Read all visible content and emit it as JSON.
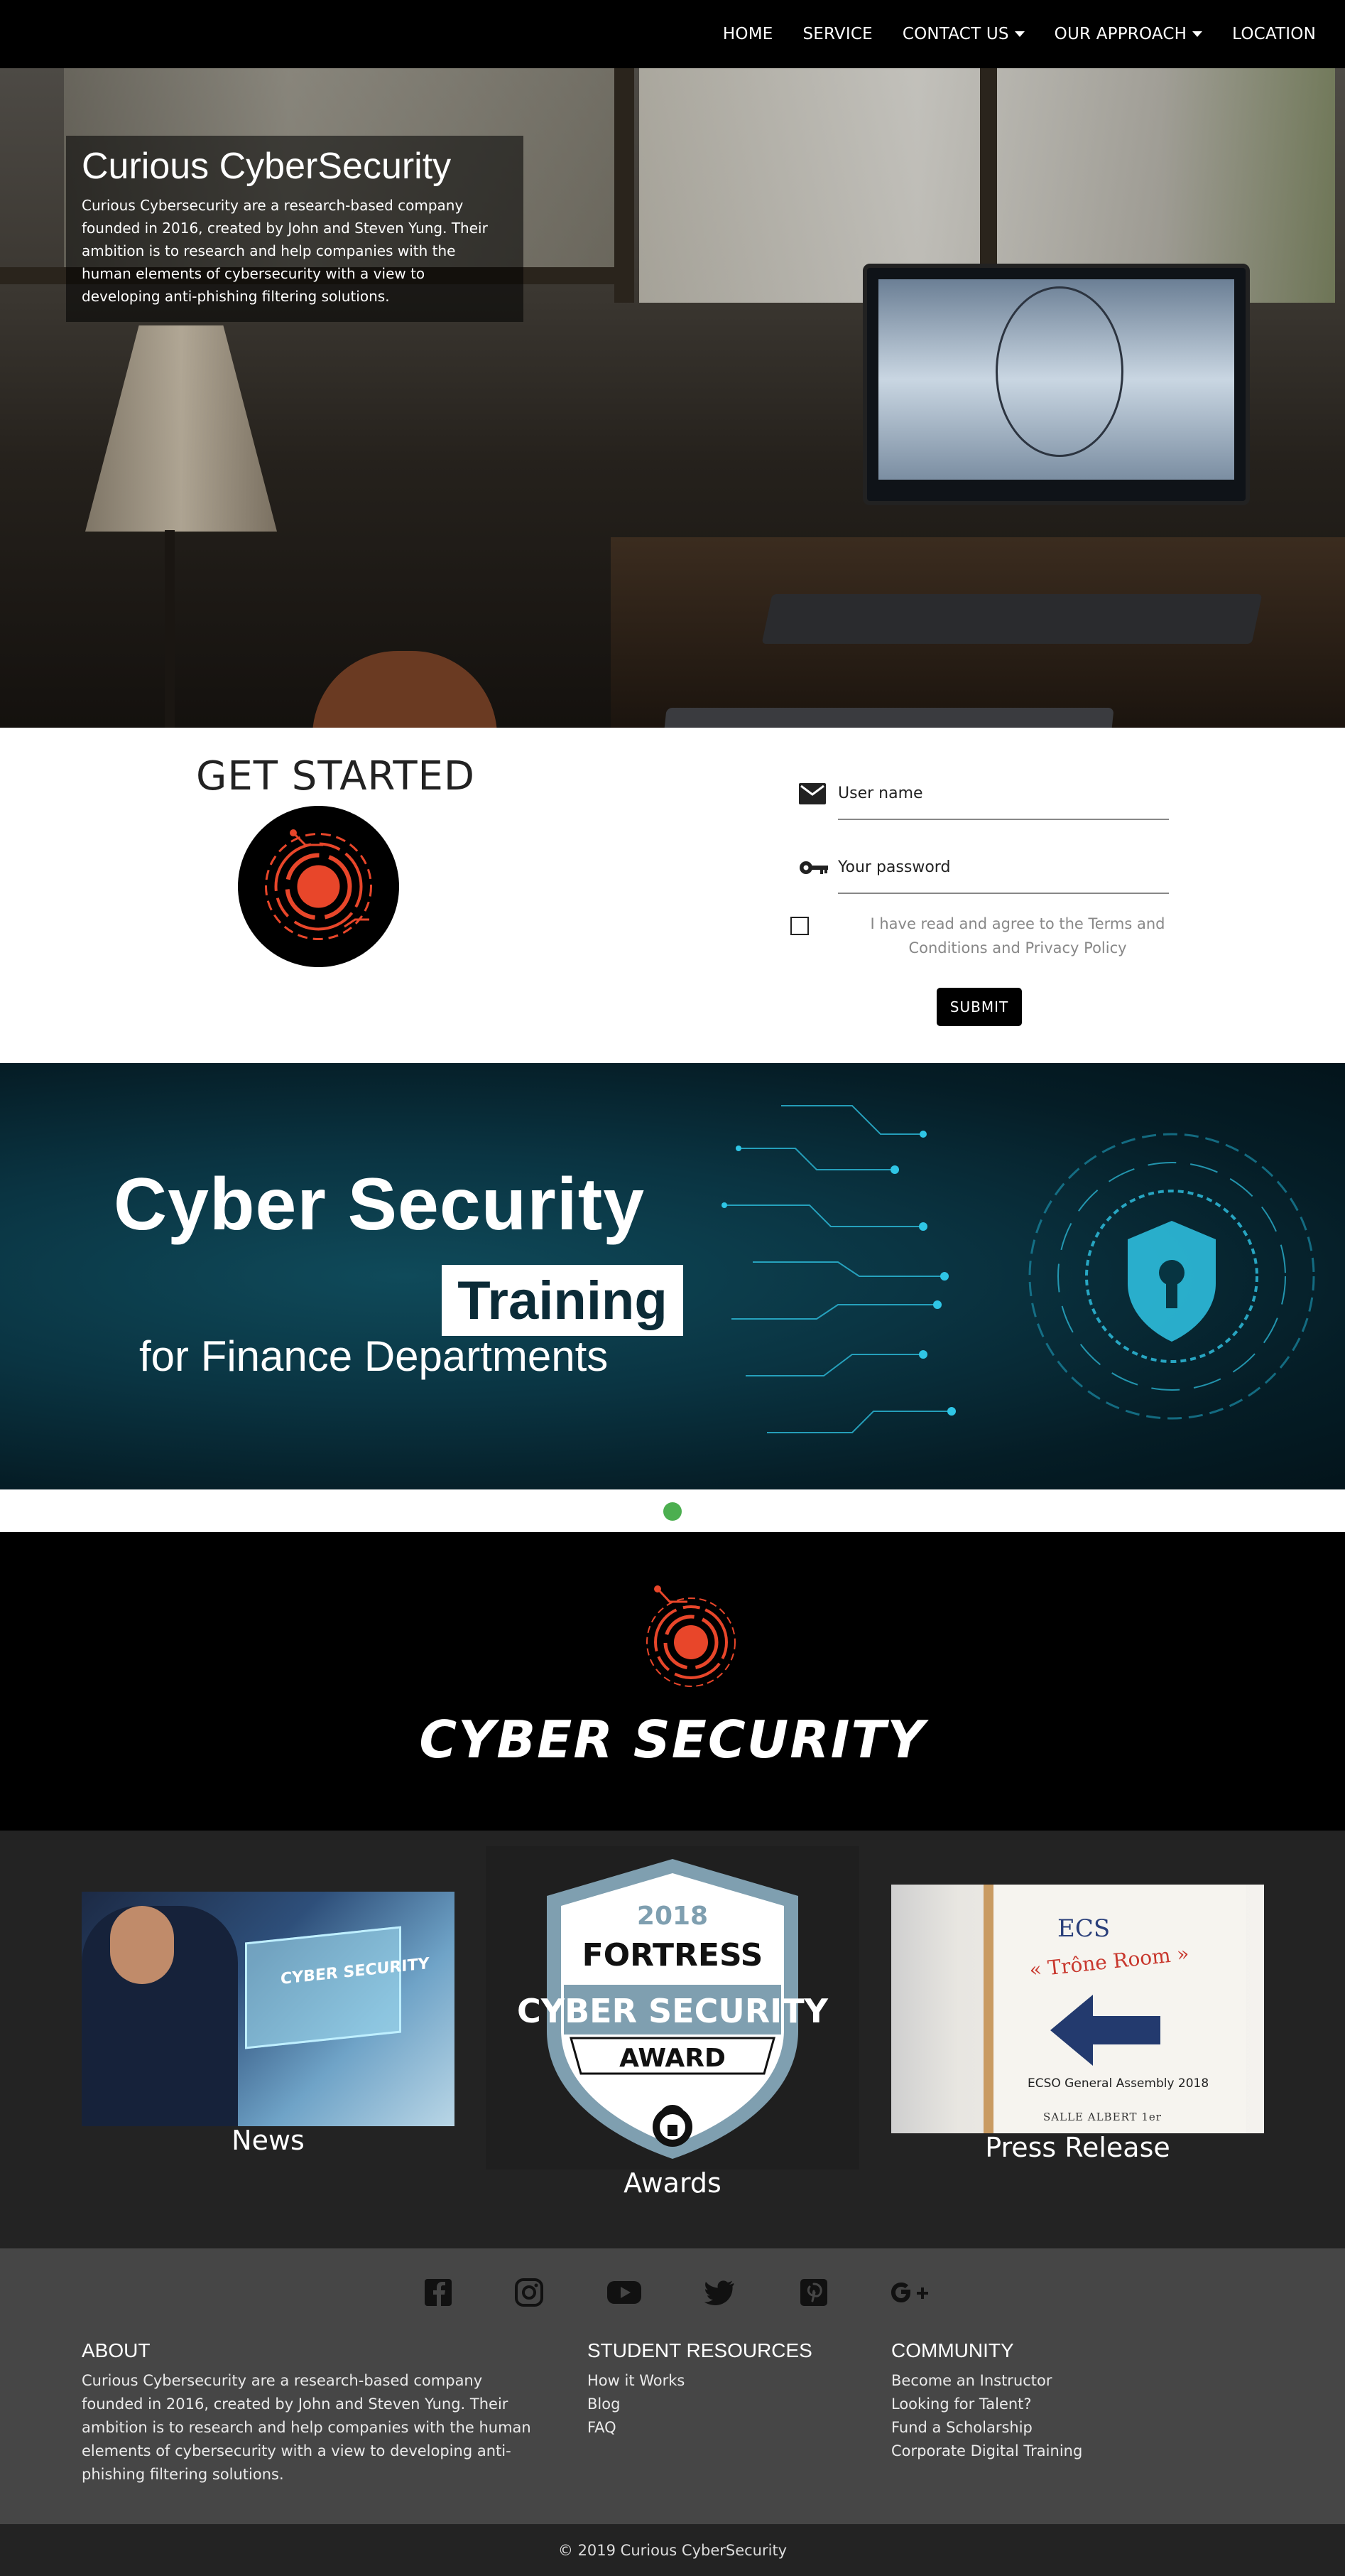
{
  "nav": {
    "items": [
      {
        "label": "HOME",
        "dropdown": false
      },
      {
        "label": "SERVICE",
        "dropdown": false
      },
      {
        "label": "CONTACT US",
        "dropdown": true
      },
      {
        "label": "OUR APPROACH",
        "dropdown": true
      },
      {
        "label": "LOCATION",
        "dropdown": false
      }
    ]
  },
  "hero": {
    "title": "Curious CyberSecurity",
    "text": "Curious Cybersecurity are a research-based company founded in 2016, created by John and Steven Yung. Their ambition is to research and help companies with the human elements of cybersecurity with a view to developing anti-phishing filtering solutions."
  },
  "get_started": {
    "title": "GET STARTED",
    "username_label": "User name",
    "password_label": "Your password",
    "terms_text": "I have read and agree to the Terms and Conditions and Privacy Policy",
    "submit_label": "SUBMIT"
  },
  "banner": {
    "line1": "Cyber Security",
    "line2": "Training",
    "line3": "for Finance Departments",
    "colors": {
      "background": "#0a3442",
      "accent": "#2fc6e6"
    }
  },
  "carousel": {
    "active_dot_color": "#4caf50"
  },
  "brand": {
    "text": "CYBER SECURITY",
    "logo_color": "#e8462a"
  },
  "cards": {
    "news_label": "News",
    "news_image_text": "CYBER SECURITY",
    "awards_label": "Awards",
    "award_year": "2018",
    "award_fortress": "FORTRESS",
    "award_cyber": "CYBER SECURITY",
    "award_word": "AWARD",
    "press_label": "Press Release",
    "press_ecs": "ECS",
    "press_room": "« Trône Room »",
    "press_assembly": "ECSO General Assembly 2018",
    "press_salle": "SALLE ALBERT 1er"
  },
  "footer": {
    "social_icons": [
      "facebook-icon",
      "instagram-icon",
      "youtube-icon",
      "twitter-icon",
      "pinterest-icon",
      "google-plus-icon"
    ],
    "about_title": "ABOUT",
    "about_text": "Curious Cybersecurity are a research-based company founded in 2016, created by John and Steven Yung. Their ambition is to research and help companies with the human elements of cybersecurity with a view to developing anti-phishing filtering solutions.",
    "student_title": "STUDENT RESOURCES",
    "student_links": [
      "How it Works",
      "Blog",
      "FAQ"
    ],
    "community_title": "COMMUNITY",
    "community_links": [
      "Become an Instructor",
      "Looking for Talent?",
      "Fund a Scholarship",
      "Corporate Digital Training"
    ],
    "copyright": "© 2019 Curious CyberSecurity"
  }
}
